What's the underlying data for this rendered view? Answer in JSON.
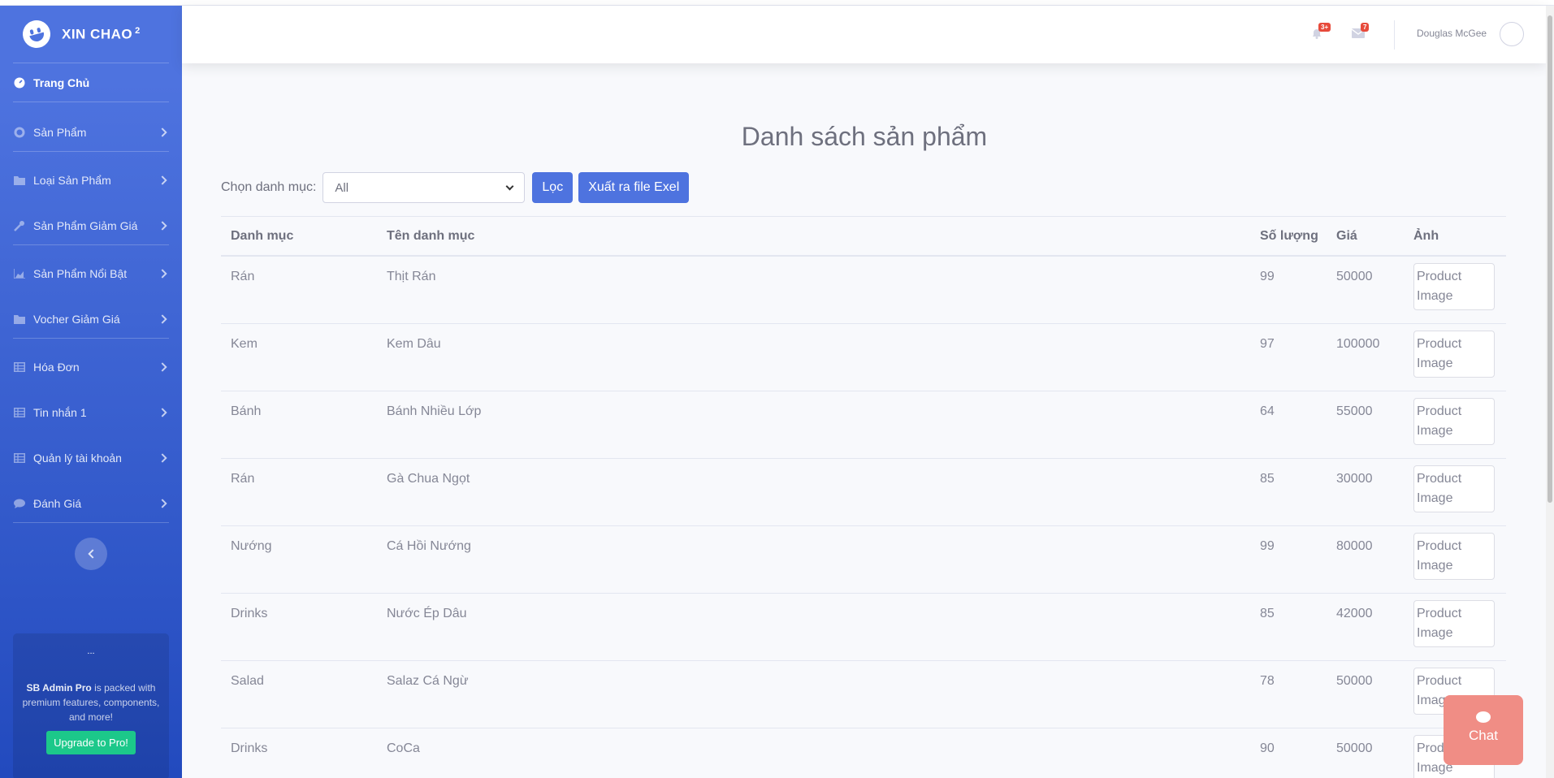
{
  "brand": {
    "name": "XIN CHAO",
    "sup": "2"
  },
  "sidebar": {
    "items": [
      {
        "label": "Trang Chủ",
        "icon": "dashboard-icon"
      },
      {
        "label": "Sản Phẩm",
        "icon": "cog-icon"
      },
      {
        "label": "Loại Sản Phẩm",
        "icon": "folder-icon"
      },
      {
        "label": "Sản Phẩm Giảm Giá",
        "icon": "wrench-icon"
      },
      {
        "label": "Sản Phẩm Nổi Bật",
        "icon": "chart-area-icon"
      },
      {
        "label": "Vocher Giảm Giá",
        "icon": "folder-icon"
      },
      {
        "label": "Hóa Đơn",
        "icon": "table-icon"
      },
      {
        "label": "Tin nhắn 1",
        "icon": "table-icon"
      },
      {
        "label": "Quản lý tài khoản",
        "icon": "table-icon"
      },
      {
        "label": "Đánh Giá",
        "icon": "comment-icon"
      }
    ],
    "promo": {
      "img_alt": "...",
      "bold": "SB Admin Pro",
      "text": " is packed with premium features, components, and more!",
      "button": "Upgrade to Pro!"
    }
  },
  "topbar": {
    "alerts_badge": "3+",
    "messages_badge": "7",
    "username": "Douglas McGee"
  },
  "main": {
    "title": "Danh sách sản phẩm",
    "filter_label": "Chọn danh mục:",
    "filter_value": "All",
    "filter_button": "Lọc",
    "export_button": "Xuất ra file Exel",
    "columns": [
      "Danh mục",
      "Tên danh mục",
      "Số lượng",
      "Giá",
      "Ảnh"
    ],
    "image_alt": "Product Image",
    "rows": [
      {
        "category": "Rán",
        "name": "Thịt Rán",
        "qty": "99",
        "price": "50000"
      },
      {
        "category": "Kem",
        "name": "Kem Dâu",
        "qty": "97",
        "price": "100000"
      },
      {
        "category": "Bánh",
        "name": "Bánh Nhiều Lớp",
        "qty": "64",
        "price": "55000"
      },
      {
        "category": "Rán",
        "name": "Gà Chua Ngọt",
        "qty": "85",
        "price": "30000"
      },
      {
        "category": "Nướng",
        "name": "Cá Hồi Nướng",
        "qty": "99",
        "price": "80000"
      },
      {
        "category": "Drinks",
        "name": "Nước Ép Dâu",
        "qty": "85",
        "price": "42000"
      },
      {
        "category": "Salad",
        "name": "Salaz Cá Ngừ",
        "qty": "78",
        "price": "50000"
      },
      {
        "category": "Drinks",
        "name": "CoCa",
        "qty": "90",
        "price": "50000"
      }
    ]
  },
  "chat": {
    "label": "Chat"
  },
  "colors": {
    "primary": "#4e73df",
    "success": "#1cc88a",
    "danger": "#e74a3b",
    "chat": "#f08d85"
  }
}
